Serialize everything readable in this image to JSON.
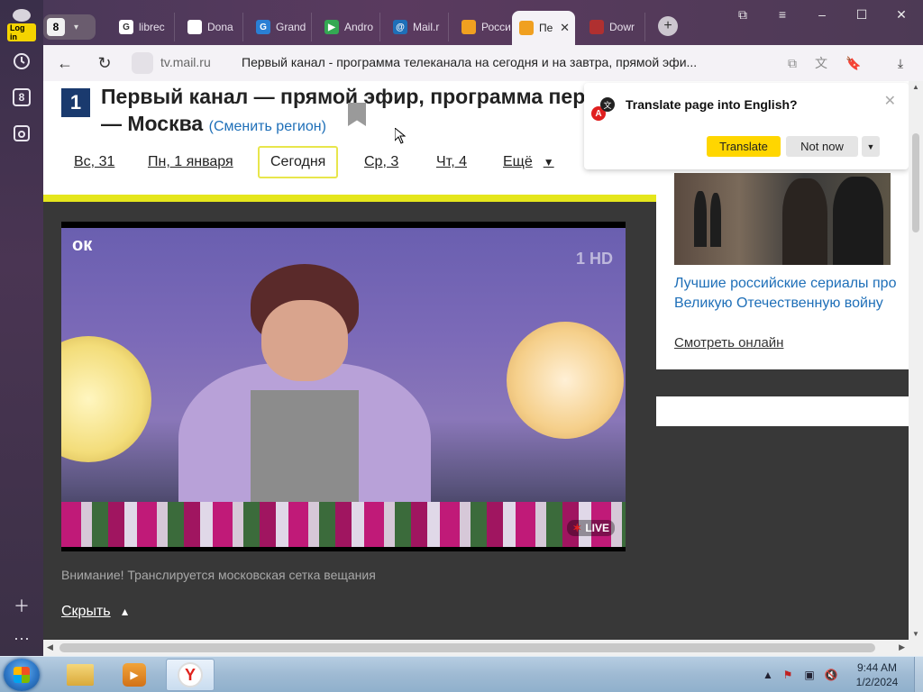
{
  "sidebar": {
    "login_label": "Log in",
    "tab_count": "8",
    "items": [
      {
        "icon": "history-icon"
      },
      {
        "icon": "tab-count-icon"
      },
      {
        "icon": "screenshot-icon"
      },
      {
        "icon": "add-icon"
      },
      {
        "icon": "more-icon"
      }
    ]
  },
  "tabbar": {
    "count": "8",
    "tabs": [
      {
        "label": "librec",
        "icon": "G",
        "color": "#ffffff"
      },
      {
        "label": "Dona",
        "icon": "doc",
        "color": "#ffffff"
      },
      {
        "label": "Grand",
        "icon": "G",
        "color": "#2a7fd4"
      },
      {
        "label": "Andro",
        "icon": "▶",
        "color": "#34a853"
      },
      {
        "label": "Mail.r",
        "icon": "@",
        "color": "#1e6fb8"
      },
      {
        "label": "Росси",
        "icon": "tv",
        "color": "#f0a020"
      },
      {
        "label": "Пе",
        "icon": "tv",
        "color": "#f0a020",
        "active": true
      },
      {
        "label": "Dowr",
        "icon": "dl",
        "color": "#b03030"
      }
    ]
  },
  "address": {
    "host": "tv.mail.ru",
    "title": "Первый канал - программа телеканала на сегодня и на завтра, прямой эфи..."
  },
  "page": {
    "channel_title": "Первый канал — прямой эфир, программа пере",
    "city": "— Москва",
    "region_link": "(Сменить регион)",
    "days": [
      {
        "label": "Вс, 31",
        "active": false
      },
      {
        "label": "Пн, 1 января",
        "active": false
      },
      {
        "label": "Сегодня",
        "active": true
      },
      {
        "label": "Ср, 3",
        "active": false
      },
      {
        "label": "Чт, 4",
        "active": false
      },
      {
        "label": "Ещё",
        "active": false
      }
    ],
    "video": {
      "hd_mark": "1 HD",
      "live_label": "LIVE",
      "ok_logo": "ок"
    },
    "notice": "Внимание! Транслируется московская сетка вещания",
    "hide_label": "Скрыть"
  },
  "promo": {
    "link": "Лучшие российские сериалы про Великую Отечественную войну",
    "watch": "Смотреть онлайн"
  },
  "translate": {
    "question": "Translate page into English?",
    "translate_btn": "Translate",
    "not_now_btn": "Not now"
  },
  "taskbar": {
    "time": "9:44 AM",
    "date": "1/2/2024"
  },
  "colors": {
    "accent_yellow": "#ffd600",
    "channel_blue": "#1a3a6e",
    "link_blue": "#1e6fb8"
  }
}
